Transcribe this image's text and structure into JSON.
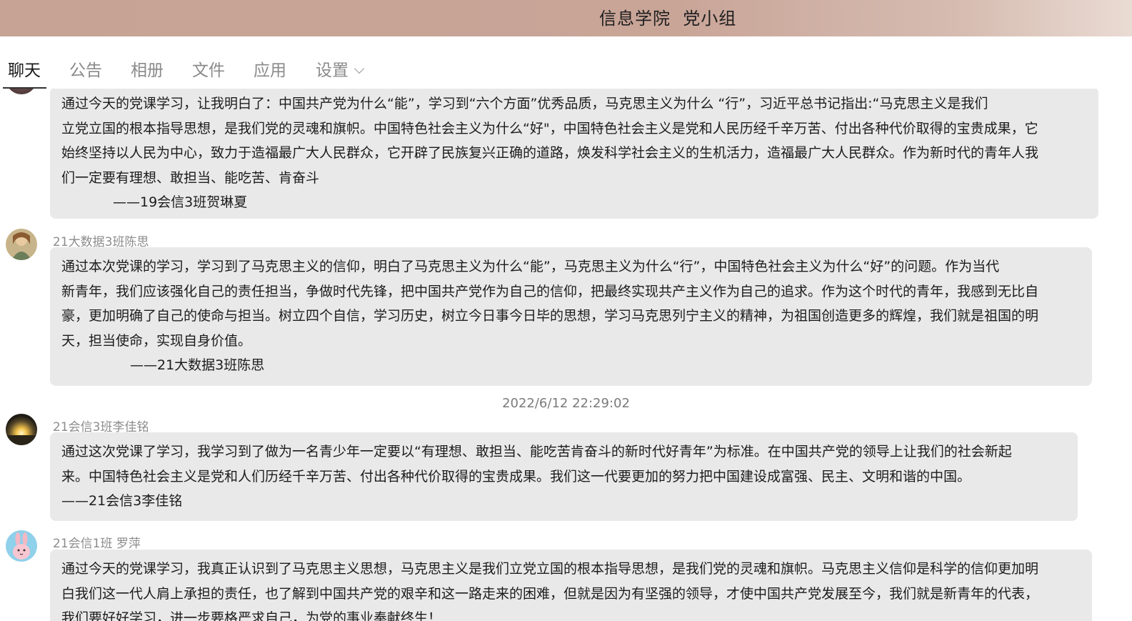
{
  "window": {
    "title": "信息学院  党小组"
  },
  "tabs": [
    {
      "label": "聊天",
      "active": true
    },
    {
      "label": "公告",
      "active": false
    },
    {
      "label": "相册",
      "active": false
    },
    {
      "label": "文件",
      "active": false
    },
    {
      "label": "应用",
      "active": false
    },
    {
      "label": "设置",
      "active": false
    }
  ],
  "messages": [
    {
      "sender": "",
      "lines": [
        "通过今天的党课学习，让我明白了：中国共产党为什么“能”，学习到“六个方面”优秀品质，马克思主义为什么 “行”，习近平总书记指出:“马克思主义是我们",
        "立党立国的根本指导思想，是我们党的灵魂和旗帜。中国特色社会主义为什么“好\"，中国特色社会主义是党和人民历经千辛万苦、付出各种代价取得的宝贵成果，它",
        "始终坚持以人民为中心，致力于造福最广大人民群众，它开辟了民族复兴正确的道路，焕发科学社会主义的生机活力，造福最广大人民群众。作为新时代的青年人我",
        "们一定要有理想、敢担当、能吃苦、肯奋斗",
        "——19会信3班贺琳夏"
      ]
    },
    {
      "sender": "21大数据3班陈思",
      "lines": [
        "通过本次党课的学习，学习到了马克思主义的信仰，明白了马克思主义为什么“能”，马克思主义为什么“行”，中国特色社会主义为什么“好”的问题。作为当代",
        "新青年，我们应该强化自己的责任担当，争做时代先锋，把中国共产党作为自己的信仰，把最终实现共产主义作为自己的追求。作为这个时代的青年，我感到无比自",
        "豪，更加明确了自己的使命与担当。树立四个自信，学习历史，树立今日事今日毕的思想，学习马克思列宁主义的精神，为祖国创造更多的辉煌，我们就是祖国的明",
        "天，担当使命，实现自身价值。",
        "——21大数据3班陈思"
      ]
    },
    {
      "timestamp": "2022/6/12 22:29:02"
    },
    {
      "sender": "21会信3班李佳铭",
      "lines": [
        "通过这次党课了学习，我学习到了做为一名青少年一定要以“有理想、敢担当、能吃苦肯奋斗的新时代好青年”为标准。在中国共产党的领导上让我们的社会新起",
        "来。中国特色社会主义是党和人们历经千辛万苦、付出各种代价取得的宝贵成果。我们这一代要更加的努力把中国建设成富强、民主、文明和谐的中国。",
        "——21会信3李佳铭"
      ]
    },
    {
      "sender": "21会信1班 罗萍",
      "lines": [
        "通过今天的党课学习，我真正认识到了马克思主义思想，马克思主义是我们立党立国的根本指导思想，是我们党的灵魂和旗帜。马克思主义信仰是科学的信仰更加明",
        "白我们这一代人肩上承担的责任，也了解到中国共产党的艰辛和这一路走来的困难，但就是因为有坚强的领导，才使中国共产党发展至今，我们就是新青年的代表，",
        "我们要好好学习，进一步要格严求自己，为党的事业奉献终生！"
      ]
    }
  ]
}
